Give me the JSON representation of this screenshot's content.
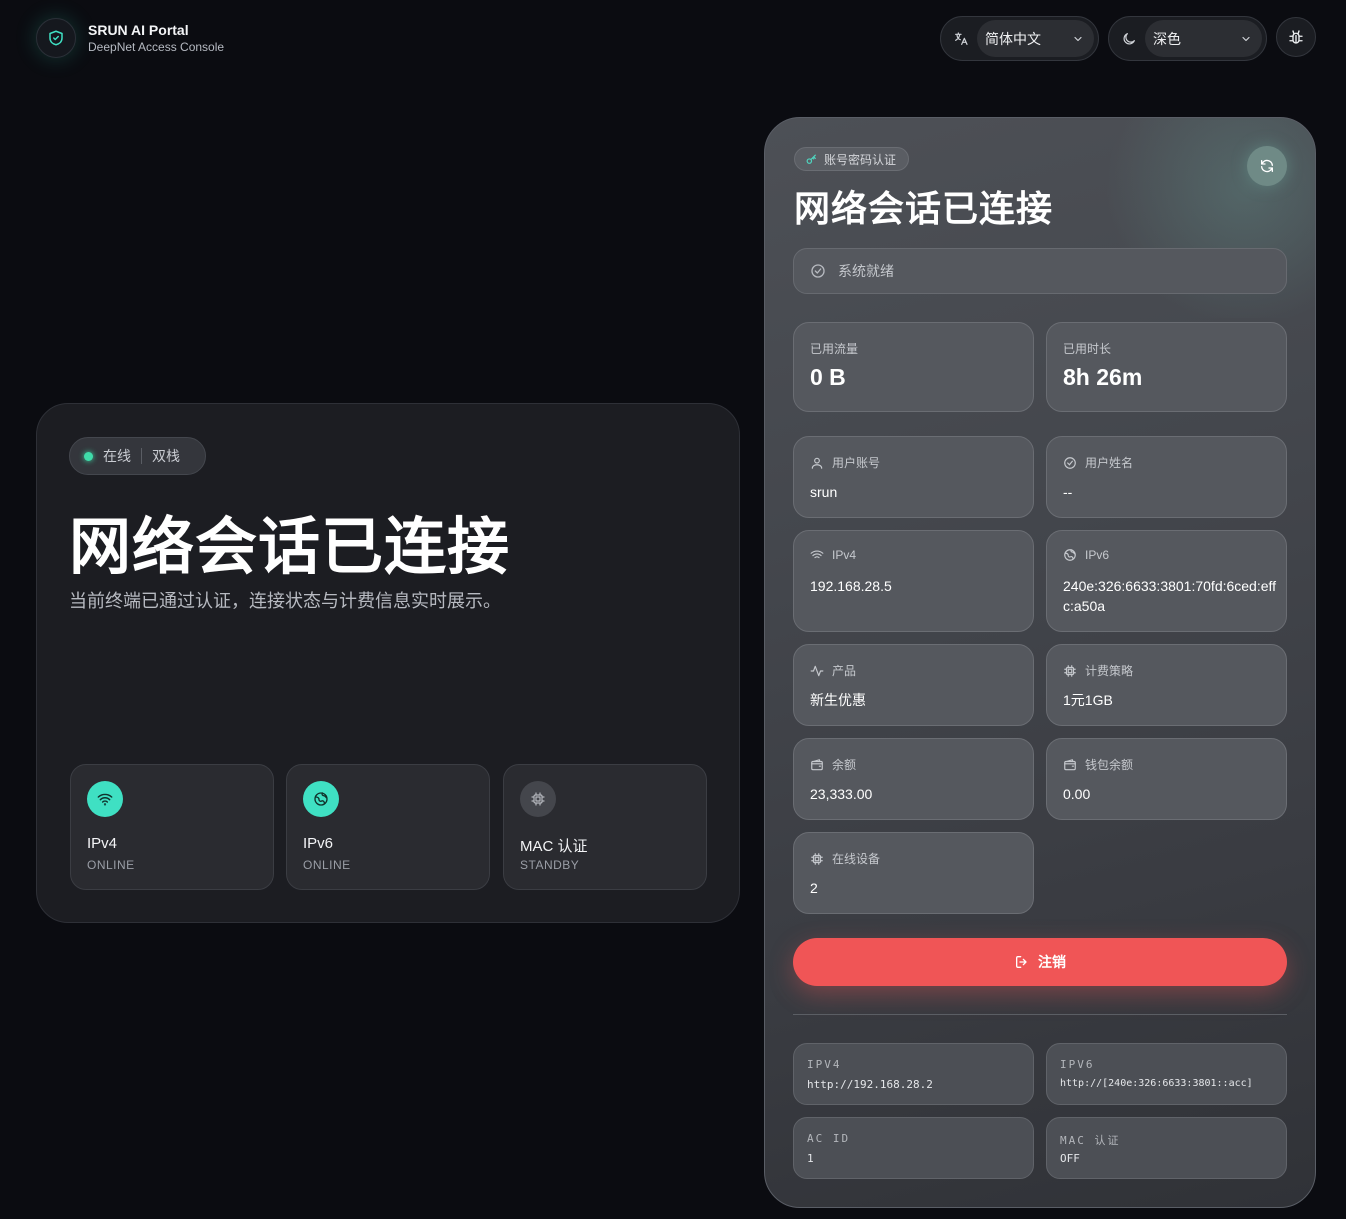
{
  "header": {
    "brand_title": "SRUN AI Portal",
    "brand_subtitle": "DeepNet Access Console",
    "language_value": "简体中文",
    "theme_value": "深色"
  },
  "hero": {
    "status_online": "在线",
    "status_stack": "双栈",
    "title": "网络会话已连接",
    "description": "当前终端已通过认证，连接状态与计费信息实时展示。",
    "protocols": [
      {
        "name": "IPv4",
        "state": "ONLINE"
      },
      {
        "name": "IPv6",
        "state": "ONLINE"
      },
      {
        "name": "MAC 认证",
        "state": "STANDBY"
      }
    ]
  },
  "panel": {
    "auth_chip": "账号密码认证",
    "title": "网络会话已连接",
    "system_status": "系统就绪",
    "stats": {
      "traffic_label": "已用流量",
      "traffic_value": "0 B",
      "duration_label": "已用时长",
      "duration_value": "8h 26m"
    },
    "fields": {
      "account_label": "用户账号",
      "account_value": "srun",
      "name_label": "用户姓名",
      "name_value": "--",
      "ipv4_label": "IPv4",
      "ipv4_value": "192.168.28.5",
      "ipv6_label": "IPv6",
      "ipv6_value": "240e:326:6633:3801:70fd:6ced:effc:a50a",
      "product_label": "产品",
      "product_value": "新生优惠",
      "billing_label": "计费策略",
      "billing_value": "1元1GB",
      "balance_label": "余额",
      "balance_value": "23,333.00",
      "wallet_label": "钱包余额",
      "wallet_value": "0.00",
      "devices_label": "在线设备",
      "devices_value": "2"
    },
    "logout_label": "注销",
    "info": {
      "ipv4_label": "IPV4",
      "ipv4_value": "http://192.168.28.2",
      "ipv6_label": "IPV6",
      "ipv6_value": "http://[240e:326:6633:3801::acc]",
      "acid_label": "AC ID",
      "acid_value": "1",
      "mac_label": "MAC 认证",
      "mac_value": "OFF"
    }
  },
  "colors": {
    "accent": "#3fe0c3",
    "online_dot": "#3fdca9",
    "logout": "#f05556"
  }
}
